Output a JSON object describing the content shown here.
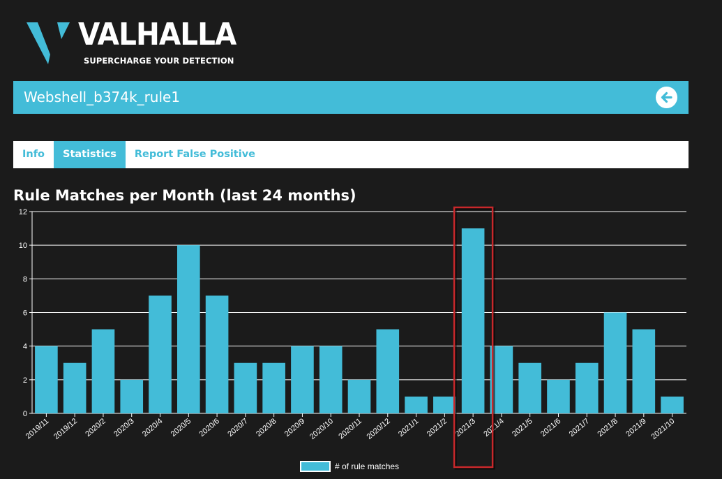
{
  "brand": {
    "name": "VALHALLA",
    "tagline": "SUPERCHARGE YOUR DETECTION",
    "logo_icon": "valhalla-v-logo"
  },
  "rule": {
    "title": "Webshell_b374k_rule1",
    "back_icon": "arrow-left-circle-icon"
  },
  "tabs": [
    {
      "label": "Info",
      "active": false
    },
    {
      "label": "Statistics",
      "active": true
    },
    {
      "label": "Report False Positive",
      "active": false
    }
  ],
  "colors": {
    "accent": "#43bcd8",
    "background": "#1b1b1b",
    "highlight_box": "#c8282b"
  },
  "chart_data": {
    "type": "bar",
    "title": "Rule Matches per Month (last 24 months)",
    "categories": [
      "2019/11",
      "2019/12",
      "2020/2",
      "2020/3",
      "2020/4",
      "2020/5",
      "2020/6",
      "2020/7",
      "2020/8",
      "2020/9",
      "2020/10",
      "2020/11",
      "2020/12",
      "2021/1",
      "2021/2",
      "2021/3",
      "2021/4",
      "2021/5",
      "2021/6",
      "2021/7",
      "2021/8",
      "2021/9",
      "2021/10"
    ],
    "series": [
      {
        "name": "# of rule matches",
        "values": [
          4,
          3,
          5,
          2,
          7,
          10,
          7,
          3,
          3,
          4,
          4,
          2,
          5,
          1,
          1,
          11,
          4,
          3,
          2,
          3,
          6,
          5,
          1
        ]
      }
    ],
    "ylim": [
      0,
      12
    ],
    "yticks": [
      0,
      2,
      4,
      6,
      8,
      10,
      12
    ],
    "grid": true,
    "legend": "bottom-center",
    "highlighted_category": "2021/3"
  }
}
